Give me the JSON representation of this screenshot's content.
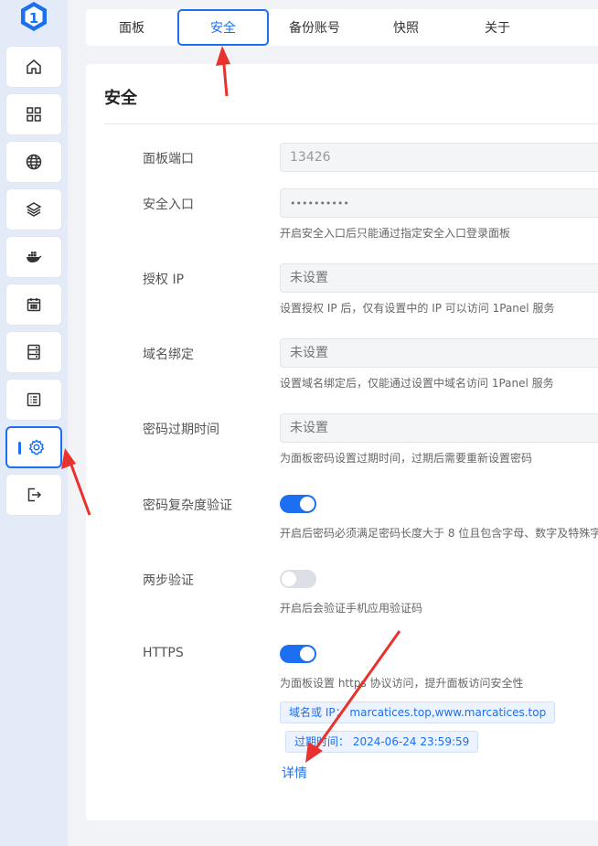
{
  "app": {
    "logo": "1"
  },
  "sidebar": {
    "items": [
      {
        "icon": "home-icon"
      },
      {
        "icon": "grid-icon"
      },
      {
        "icon": "globe-icon"
      },
      {
        "icon": "layers-icon"
      },
      {
        "icon": "docker-icon"
      },
      {
        "icon": "calendar-icon"
      },
      {
        "icon": "server-icon"
      },
      {
        "icon": "log-list-icon"
      },
      {
        "icon": "gear-icon",
        "active": true
      },
      {
        "icon": "logout-icon"
      }
    ]
  },
  "tabs": [
    "面板",
    "安全",
    "备份账号",
    "快照",
    "关于"
  ],
  "active_tab": "安全",
  "security": {
    "title": "安全",
    "port_label": "面板端口",
    "port_value": "13426",
    "entrance_label": "安全入口",
    "entrance_value": "••••••••••",
    "entrance_hint": "开启安全入口后只能通过指定安全入口登录面板",
    "ip_label": "授权 IP",
    "ip_placeholder": "未设置",
    "ip_hint": "设置授权 IP 后，仅有设置中的 IP 可以访问 1Panel 服务",
    "domain_label": "域名绑定",
    "domain_placeholder": "未设置",
    "domain_hint": "设置域名绑定后，仅能通过设置中域名访问 1Panel 服务",
    "expire_label": "密码过期时间",
    "expire_placeholder": "未设置",
    "expire_hint": "为面板密码设置过期时间，过期后需要重新设置密码",
    "complexity_label": "密码复杂度验证",
    "complexity_on": true,
    "complexity_hint": "开启后密码必须满足密码长度大于 8 位且包含字母、数字及特殊字",
    "mfa_label": "两步验证",
    "mfa_on": false,
    "mfa_hint": "开启后会验证手机应用验证码",
    "https_label": "HTTPS",
    "https_on": true,
    "https_hint": "为面板设置 https 协议访问，提升面板访问安全性",
    "cert_domain_tag": "域名或 IP：   marcatices.top,www.marcatices.top",
    "cert_expire_tag": "过期时间：  2024-06-24 23:59:59",
    "details_link": "详情"
  },
  "colors": {
    "accent": "#1d6ff2",
    "annotation": "#e8322e",
    "sidebar_bg": "#e3ebf8"
  }
}
